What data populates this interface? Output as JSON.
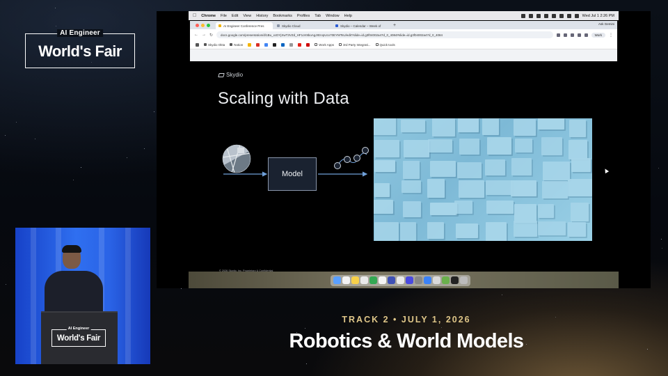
{
  "event_logo": {
    "small": "AI Engineer",
    "big": "World's Fair"
  },
  "lower_third": {
    "track": "TRACK 2 • JULY 1, 2026",
    "session": "Robotics & World Models"
  },
  "mac_menubar": {
    "app": "Chrome",
    "menus": [
      "File",
      "Edit",
      "View",
      "History",
      "Bookmarks",
      "Profiles",
      "Tab",
      "Window",
      "Help"
    ],
    "clock": "Wed Jul 1  2:26 PM"
  },
  "browser": {
    "tabs": [
      {
        "label": "AI Engineer Conference Pres"
      },
      {
        "label": "Skydio Cloud"
      },
      {
        "label": "Skydio – Calendar – Week of"
      }
    ],
    "new_tab": "+",
    "ask_gemini": "Ask Gemini",
    "url": "docs.google.com/presentation/d/1Bu_xcDYjXwT3VZd_HF1cK9boAgJrErvpUcx70EYMTsU/edit?slide=id.g3f04002a47d_0_4084#slide=id.g3f04002a47d_0_4084",
    "profile": "Work",
    "bookmarks": [
      "Skydio Okta",
      "Notion",
      "Work Apps",
      "3rd Party Integrati...",
      "Quick tools"
    ]
  },
  "slide": {
    "brand": "Skydio",
    "title": "Scaling with Data",
    "model_label": "Model",
    "footer": "© 2026 Skydio, Inc. Proprietary & Confidential"
  },
  "podium_logo": {
    "small": "AI Engineer",
    "big": "World's Fair"
  },
  "colors": {
    "gold": "#e0c789",
    "camera_blue": "#2f6ff0",
    "city_blue": "#8fc7df"
  }
}
